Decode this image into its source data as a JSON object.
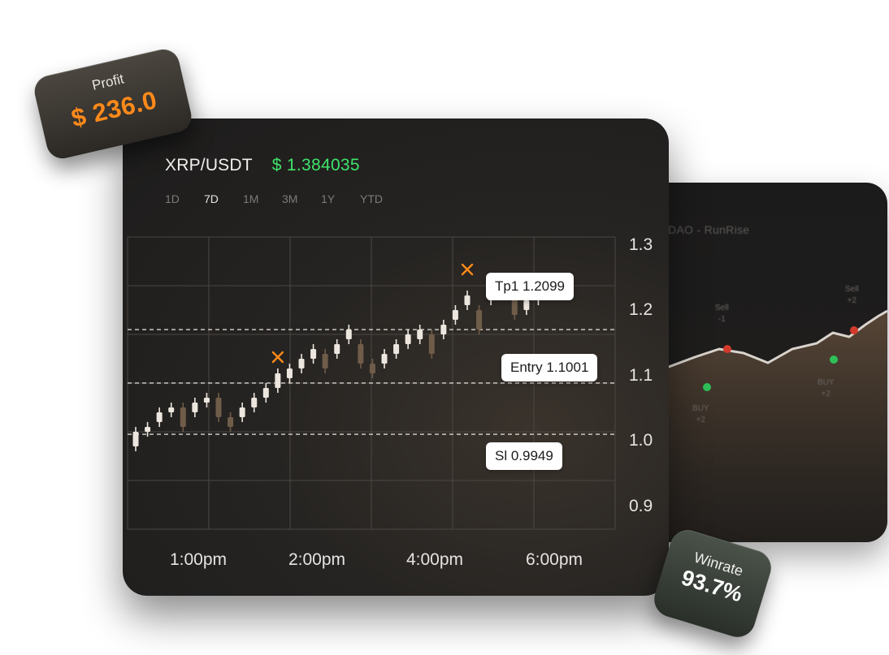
{
  "back_panel": {
    "title": "DAO - RunRise",
    "signals": [
      {
        "label": "Sell",
        "value": "-1"
      },
      {
        "label": "BUY",
        "value": "+2"
      },
      {
        "label": "BUY",
        "value": "+2"
      },
      {
        "label": "Sell",
        "value": "+2"
      }
    ]
  },
  "main": {
    "pair": "XRP/USDT",
    "price": "$ 1.384035",
    "ranges": [
      "1D",
      "7D",
      "1M",
      "3M",
      "1Y",
      "YTD"
    ],
    "active_range": "7D",
    "levels": {
      "tp": "Tp1 1.2099",
      "entry": "Entry 1.1001",
      "sl": "Sl 0.9949"
    },
    "y_axis": [
      "1.3",
      "1.2",
      "1.1",
      "1.0",
      "0.9"
    ],
    "x_axis": [
      "1:00pm",
      "2:00pm",
      "4:00pm",
      "6:00pm"
    ]
  },
  "badges": {
    "profit_label": "Profit",
    "profit_value": "$ 236.0",
    "winrate_label": "Winrate",
    "winrate_value": "93.7%"
  },
  "colors": {
    "price_green": "#3fe36a",
    "profit_orange": "#ff8a1a",
    "candle_up": "#ece6de",
    "candle_down": "#6f5c49",
    "marker": "#ff8a1a"
  },
  "chart_data": {
    "type": "candlestick",
    "y_range": [
      0.9,
      1.3
    ],
    "candles": [
      {
        "o": 0.97,
        "c": 1.0,
        "h": 1.01,
        "l": 0.96
      },
      {
        "o": 1.0,
        "c": 1.01,
        "h": 1.02,
        "l": 0.99
      },
      {
        "o": 1.02,
        "c": 1.04,
        "h": 1.05,
        "l": 1.01
      },
      {
        "o": 1.04,
        "c": 1.05,
        "h": 1.06,
        "l": 1.03
      },
      {
        "o": 1.05,
        "c": 1.01,
        "h": 1.06,
        "l": 1.0
      },
      {
        "o": 1.04,
        "c": 1.06,
        "h": 1.07,
        "l": 1.03
      },
      {
        "o": 1.06,
        "c": 1.07,
        "h": 1.08,
        "l": 1.05
      },
      {
        "o": 1.07,
        "c": 1.03,
        "h": 1.08,
        "l": 1.02
      },
      {
        "o": 1.03,
        "c": 1.01,
        "h": 1.04,
        "l": 1.0
      },
      {
        "o": 1.03,
        "c": 1.05,
        "h": 1.06,
        "l": 1.02
      },
      {
        "o": 1.05,
        "c": 1.07,
        "h": 1.08,
        "l": 1.04
      },
      {
        "o": 1.07,
        "c": 1.09,
        "h": 1.1,
        "l": 1.06
      },
      {
        "o": 1.09,
        "c": 1.12,
        "h": 1.13,
        "l": 1.08
      },
      {
        "o": 1.11,
        "c": 1.13,
        "h": 1.14,
        "l": 1.1
      },
      {
        "o": 1.13,
        "c": 1.15,
        "h": 1.16,
        "l": 1.12
      },
      {
        "o": 1.15,
        "c": 1.17,
        "h": 1.18,
        "l": 1.14
      },
      {
        "o": 1.16,
        "c": 1.13,
        "h": 1.17,
        "l": 1.12
      },
      {
        "o": 1.16,
        "c": 1.18,
        "h": 1.19,
        "l": 1.15
      },
      {
        "o": 1.19,
        "c": 1.21,
        "h": 1.22,
        "l": 1.18
      },
      {
        "o": 1.18,
        "c": 1.14,
        "h": 1.19,
        "l": 1.13
      },
      {
        "o": 1.14,
        "c": 1.12,
        "h": 1.15,
        "l": 1.11
      },
      {
        "o": 1.14,
        "c": 1.16,
        "h": 1.17,
        "l": 1.13
      },
      {
        "o": 1.16,
        "c": 1.18,
        "h": 1.19,
        "l": 1.15
      },
      {
        "o": 1.18,
        "c": 1.2,
        "h": 1.21,
        "l": 1.17
      },
      {
        "o": 1.19,
        "c": 1.21,
        "h": 1.22,
        "l": 1.18
      },
      {
        "o": 1.2,
        "c": 1.16,
        "h": 1.21,
        "l": 1.15
      },
      {
        "o": 1.2,
        "c": 1.22,
        "h": 1.23,
        "l": 1.19
      },
      {
        "o": 1.23,
        "c": 1.25,
        "h": 1.26,
        "l": 1.22
      },
      {
        "o": 1.26,
        "c": 1.28,
        "h": 1.29,
        "l": 1.25
      },
      {
        "o": 1.25,
        "c": 1.21,
        "h": 1.26,
        "l": 1.2
      },
      {
        "o": 1.27,
        "c": 1.29,
        "h": 1.3,
        "l": 1.26
      },
      {
        "o": 1.29,
        "c": 1.31,
        "h": 1.32,
        "l": 1.28
      },
      {
        "o": 1.28,
        "c": 1.24,
        "h": 1.29,
        "l": 1.23
      },
      {
        "o": 1.25,
        "c": 1.27,
        "h": 1.28,
        "l": 1.24
      },
      {
        "o": 1.27,
        "c": 1.29,
        "h": 1.3,
        "l": 1.26
      },
      {
        "o": 1.29,
        "c": 1.31,
        "h": 1.32,
        "l": 1.28
      }
    ],
    "markers": [
      {
        "candle": 12,
        "value": 1.13
      },
      {
        "candle": 28,
        "value": 1.31
      }
    ],
    "levels": [
      {
        "name": "Tp1",
        "value": 1.2099
      },
      {
        "name": "Entry",
        "value": 1.1001
      },
      {
        "name": "Sl",
        "value": 0.9949
      }
    ]
  }
}
